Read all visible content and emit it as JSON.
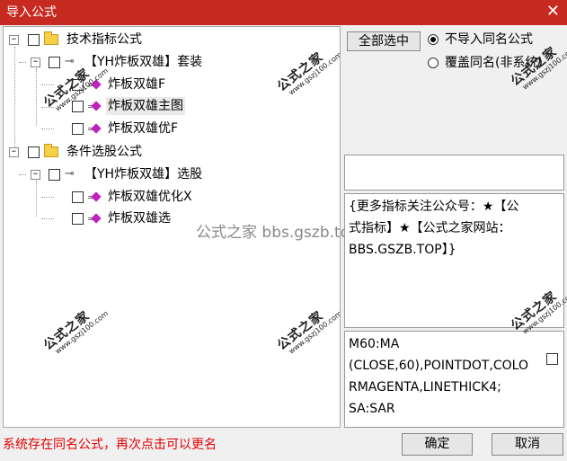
{
  "window": {
    "title": "导入公式",
    "close_glyph": "✕"
  },
  "tree": {
    "nodes": [
      {
        "label": "技术指标公式"
      },
      {
        "label": "【YH炸板双雄】套装"
      },
      {
        "label": "炸板双雄F"
      },
      {
        "label": "炸板双雄主图"
      },
      {
        "label": "炸板双雄优F"
      },
      {
        "label": "条件选股公式"
      },
      {
        "label": "【YH炸板双雄】选股"
      },
      {
        "label": "炸板双雄优化X"
      },
      {
        "label": "炸板双雄选"
      }
    ]
  },
  "watermark": {
    "name": "公式之家",
    "url": "www.gszj100.com",
    "center_text": "公式之家 bbs.gszb.top"
  },
  "controls": {
    "select_all_label": "全部选中",
    "radio_options": [
      {
        "label": "不导入同名公式",
        "selected": true
      },
      {
        "label": "覆盖同名(非系统)",
        "selected": false
      }
    ]
  },
  "description": {
    "lines": [
      "{更多指标关注公众号：★【公",
      "式指标】★【公式之家网站：",
      "BBS.GSZB.TOP】}"
    ]
  },
  "code": {
    "lines": [
      "M60:MA",
      "(CLOSE,60),POINTDOT,COLO",
      "RMAGENTA,LINETHICK4;",
      "SA:SAR"
    ]
  },
  "status": {
    "message": "系统存在同名公式，再次点击可以更名"
  },
  "buttons": {
    "ok_label": "确定",
    "cancel_label": "取消"
  },
  "colors": {
    "titlebar": "#c62a20",
    "status_text": "#e00000",
    "diamond_icon": "#c020c0"
  }
}
